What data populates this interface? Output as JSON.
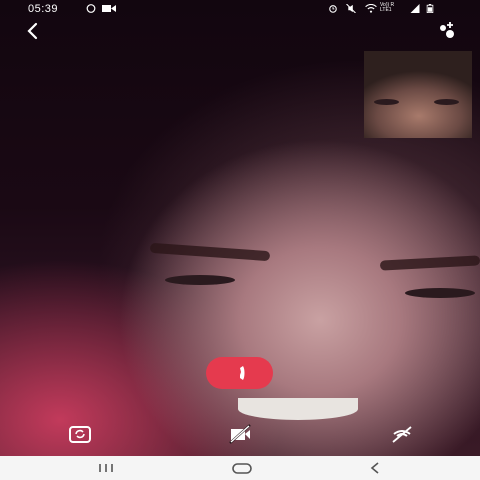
{
  "status_bar": {
    "time": "05:39",
    "network_label": "Vo)) R LTE1",
    "network_label_2": "LTE",
    "icons": [
      "whatsapp-icon",
      "video-icon",
      "alarm-icon",
      "mute-icon",
      "wifi-icon",
      "signal-icon",
      "battery-icon"
    ]
  },
  "call": {
    "back_icon": "chevron-left-icon",
    "add_participant_icon": "add-participant-icon",
    "end_call_icon": "phone-hangup-icon",
    "end_call_color": "#e53a4e",
    "controls": [
      {
        "name": "switch-camera",
        "icon": "switch-camera-icon"
      },
      {
        "name": "camera-off",
        "icon": "video-off-icon"
      },
      {
        "name": "mute-mic",
        "icon": "mic-off-icon"
      }
    ]
  },
  "nav_bar": {
    "buttons": [
      "recent-apps-icon",
      "home-icon",
      "back-icon"
    ]
  }
}
